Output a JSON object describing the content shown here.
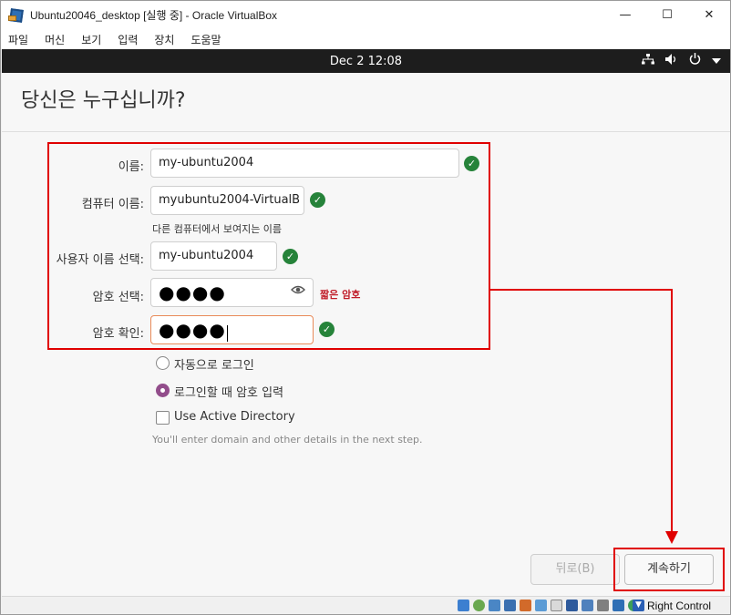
{
  "window": {
    "title": "Ubuntu20046_desktop [실행 중] - Oracle VirtualBox",
    "controls": [
      "—",
      "☐",
      "✕"
    ]
  },
  "menu": [
    "파일",
    "머신",
    "보기",
    "입력",
    "장치",
    "도움말"
  ],
  "guest_topbar": {
    "clock": "Dec 2  12:08",
    "icons": [
      "network-icon",
      "volume-icon",
      "power-icon",
      "dropdown-arrow-icon"
    ]
  },
  "page": {
    "heading": "당신은 누구십니까?",
    "fields": {
      "name_label": "이름:",
      "name_value": "my-ubuntu2004",
      "computer_label": "컴퓨터 이름:",
      "computer_value": "myubuntu2004-VirtualB",
      "computer_hint": "다른 컴퓨터에서 보여지는 이름",
      "username_label": "사용자 이름 선택:",
      "username_value": "my-ubuntu2004",
      "password_label": "암호 선택:",
      "password_value": "●●●●",
      "password_strength": "짧은 암호",
      "confirm_label": "암호 확인:",
      "confirm_value": "●●●●",
      "check_glyph": "✓",
      "eye_glyph": "👁"
    },
    "options": {
      "auto_login": "자동으로 로그인",
      "require_password": "로그인할 때 암호 입력",
      "selected": "require_password",
      "active_directory": "Use Active Directory",
      "active_directory_checked": false,
      "note": "You'll enter domain and other details in the next step."
    },
    "buttons": {
      "back": "뒤로(B)",
      "continue": "계속하기"
    }
  },
  "statusbar": {
    "host_key": "Right Control"
  },
  "colors": {
    "annotation_red": "#e00000",
    "check_green": "#26833a",
    "radio_purple": "#924d8b",
    "weak_red": "#c01c28",
    "focus_orange": "#e98a59"
  }
}
